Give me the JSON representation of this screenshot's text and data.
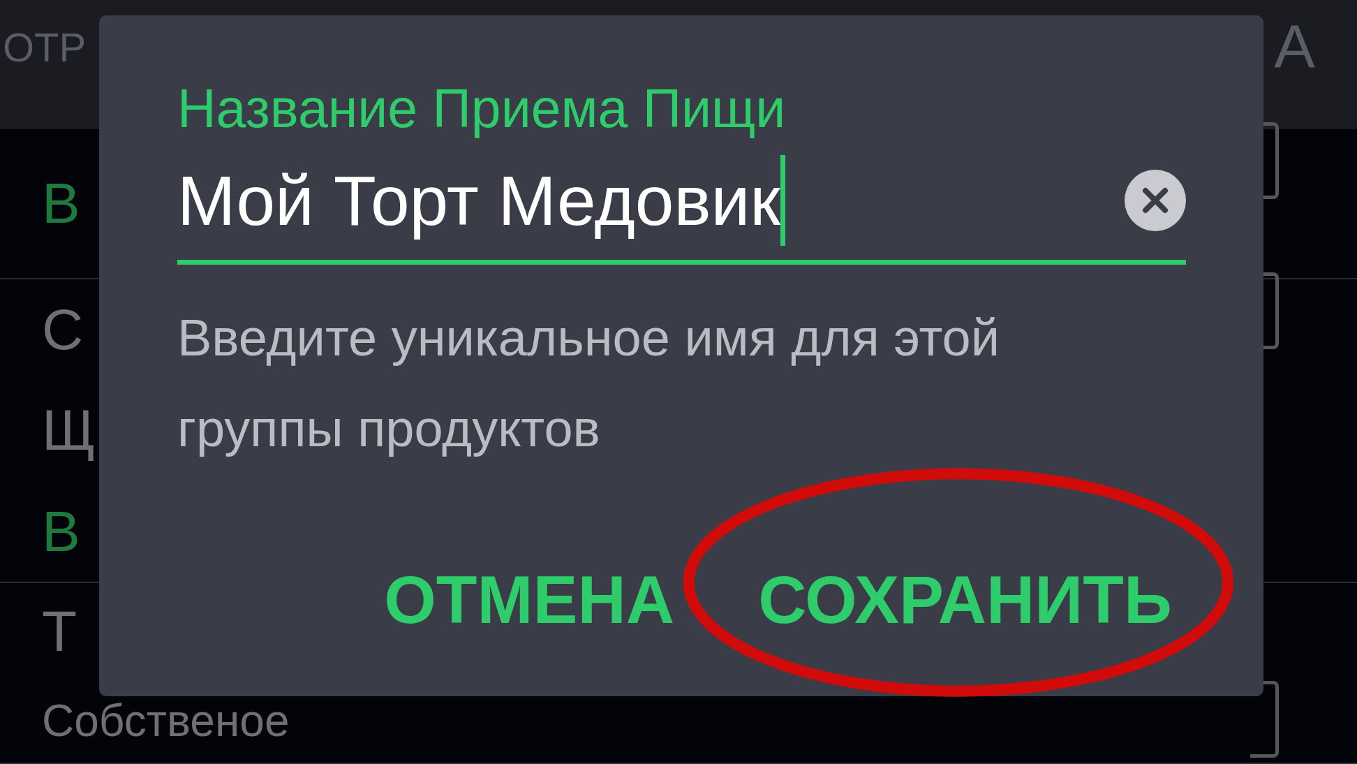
{
  "background": {
    "header": {
      "left_text": "ОТР",
      "right_text": "А"
    },
    "rows": [
      {
        "items": [
          {
            "text": "В",
            "kind": "accent"
          }
        ]
      },
      {
        "items": [
          {
            "text": "С",
            "kind": "plain"
          },
          {
            "text": "Щ",
            "kind": "plain"
          },
          {
            "text": "В",
            "kind": "accent"
          }
        ]
      },
      {
        "items": [
          {
            "text": "Т",
            "kind": "plain"
          },
          {
            "text": "Собственое",
            "kind": "plain"
          }
        ]
      }
    ]
  },
  "dialog": {
    "field": {
      "label": "Название Приема Пищи",
      "value": "Мой Торт Медовик",
      "focused": true
    },
    "helper_text": "Введите уникальное имя для этой группы продуктов",
    "buttons": [
      {
        "label": "ОТМЕНА",
        "kind": "plain"
      },
      {
        "label": "СОХРАНИТЬ",
        "kind": "circled"
      }
    ]
  }
}
